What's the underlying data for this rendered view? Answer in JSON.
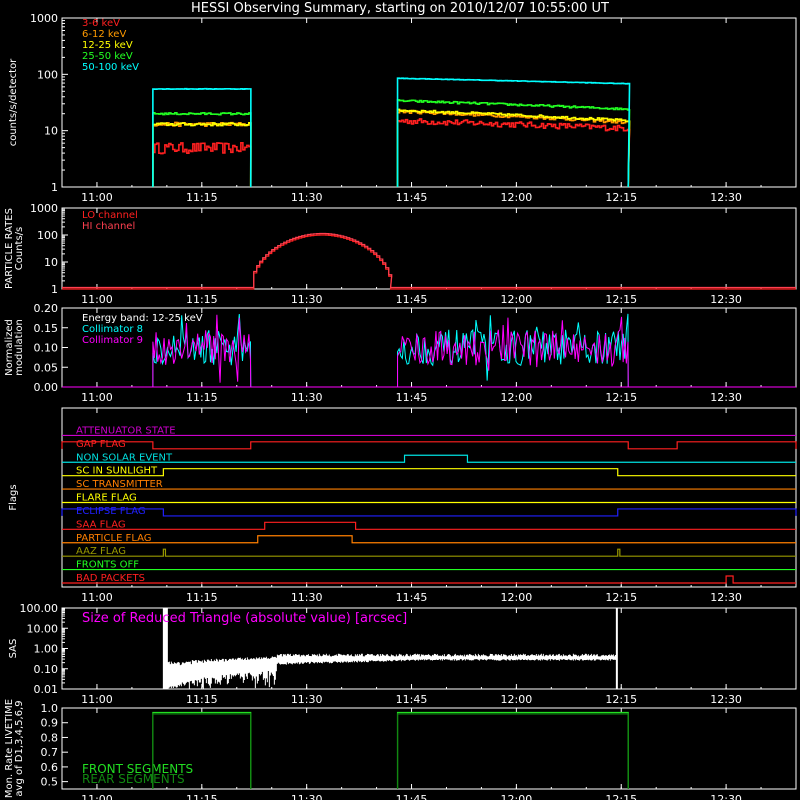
{
  "title": "HESSI Observing Summary, starting on 2010/12/07 10:55:00 UT",
  "colors": {
    "band_3_6": "#ff2020",
    "band_6_12": "#ff9a00",
    "band_12_25": "#ffff00",
    "band_25_50": "#22ff22",
    "band_50_100": "#00ffff",
    "lo_channel": "#ff2020",
    "hi_channel": "#ff4050",
    "coll8": "#00ffff",
    "coll9": "#ff00ff",
    "front": "#22dd22",
    "rear": "#118811",
    "sas": "#ffffff"
  },
  "time_axis": {
    "xlim_minutes": [
      -5,
      100
    ],
    "tick_labels": [
      "11:00",
      "11:15",
      "11:30",
      "11:45",
      "12:00",
      "12:15",
      "12:30"
    ],
    "tick_minutes": [
      0,
      15,
      30,
      45,
      60,
      75,
      90
    ]
  },
  "chart_data": [
    {
      "type": "line",
      "id": "count_rates",
      "ylabel": "counts/s/detector",
      "yscale": "log",
      "ylim": [
        1,
        1000
      ],
      "ytick_labels": [
        "1",
        "10",
        "100",
        "1000"
      ],
      "legend_placement": "top-left",
      "x_unit": "minutes after 11:00",
      "series": [
        {
          "name": "3-6 keV",
          "color_key": "band_3_6",
          "segments": [
            {
              "x": [
                8,
                22
              ],
              "level": 5,
              "noise": 0.22
            },
            {
              "x": [
                43,
                76
              ],
              "level": 15,
              "end_level": 11,
              "noise": 0.12
            }
          ]
        },
        {
          "name": "6-12 keV",
          "color_key": "band_6_12",
          "segments": [
            {
              "x": [
                8,
                22
              ],
              "level": 13,
              "noise": 0.08
            },
            {
              "x": [
                43,
                76
              ],
              "level": 22,
              "end_level": 14,
              "noise": 0.06
            }
          ]
        },
        {
          "name": "12-25 keV",
          "color_key": "band_12_25",
          "segments": [
            {
              "x": [
                8,
                22
              ],
              "level": 13,
              "noise": 0.06
            },
            {
              "x": [
                43,
                76
              ],
              "level": 23,
              "end_level": 15,
              "noise": 0.05
            }
          ]
        },
        {
          "name": "25-50 keV",
          "color_key": "band_25_50",
          "segments": [
            {
              "x": [
                8,
                22
              ],
              "level": 20,
              "noise": 0.04
            },
            {
              "x": [
                43,
                76
              ],
              "level": 34,
              "end_level": 24,
              "noise": 0.04
            }
          ]
        },
        {
          "name": "50-100 keV",
          "color_key": "band_50_100",
          "segments": [
            {
              "x": [
                8,
                22
              ],
              "level": 55,
              "noise": 0.01
            },
            {
              "x": [
                43,
                76
              ],
              "level": 85,
              "end_level": 68,
              "noise": 0.01
            }
          ]
        }
      ]
    },
    {
      "type": "line",
      "id": "particle_rates",
      "ylabel": "PARTICLE RATES",
      "ylabel2": "Counts/s",
      "yscale": "log",
      "ylim": [
        1,
        1000
      ],
      "ytick_labels": [
        "1",
        "10",
        "100",
        "1000"
      ],
      "series": [
        {
          "name": "LO channel",
          "color_key": "lo_channel"
        },
        {
          "name": "HI channel",
          "color_key": "hi_channel"
        }
      ],
      "profile": {
        "x_start": 22,
        "x_end": 42,
        "peak": 100,
        "baseline": 1
      }
    },
    {
      "type": "line",
      "id": "modulation",
      "ylabel": "Normalized",
      "ylabel2": "modulation",
      "ylim": [
        0,
        0.2
      ],
      "ytick_labels": [
        "0.00",
        "0.05",
        "0.10",
        "0.15",
        "0.20"
      ],
      "annotation": "Energy band: 12-25 keV",
      "series": [
        {
          "name": "Collimator 8",
          "color_key": "coll8",
          "segments": [
            {
              "x": [
                8,
                22
              ],
              "level": 0.1
            },
            {
              "x": [
                43,
                76
              ],
              "level": 0.1
            }
          ]
        },
        {
          "name": "Collimator 9",
          "color_key": "coll9",
          "segments": [
            {
              "x": [
                8,
                22
              ],
              "level": 0.1
            },
            {
              "x": [
                43,
                76
              ],
              "level": 0.1
            }
          ]
        }
      ]
    },
    {
      "type": "line",
      "id": "flags",
      "ylabel": "Flags",
      "flags": [
        {
          "name": "ATTENUATOR STATE",
          "color": "#cc00cc",
          "high_intervals": []
        },
        {
          "name": "GAP FLAG",
          "color": "#ff2020",
          "high_intervals": [
            [
              -5,
              8
            ],
            [
              22,
              76
            ],
            [
              83,
              100
            ]
          ]
        },
        {
          "name": "NON SOLAR EVENT",
          "color": "#00e0e0",
          "high_intervals": [
            [
              44,
              53
            ]
          ]
        },
        {
          "name": "SC IN SUNLIGHT",
          "color": "#ffff00",
          "high_intervals": [
            [
              9.5,
              74.5
            ]
          ]
        },
        {
          "name": "SC TRANSMITTER",
          "color": "#ff7f00",
          "high_intervals": []
        },
        {
          "name": "FLARE FLAG",
          "color": "#ffff00",
          "high_intervals": []
        },
        {
          "name": "ECLIPSE FLAG",
          "color": "#2020ff",
          "high_intervals": [
            [
              -5,
              9.5
            ],
            [
              74.5,
              100
            ]
          ]
        },
        {
          "name": "SAA FLAG",
          "color": "#ff2020",
          "high_intervals": [
            [
              24,
              37
            ]
          ]
        },
        {
          "name": "PARTICLE FLAG",
          "color": "#ff7f00",
          "high_intervals": [
            [
              23,
              36.5
            ]
          ]
        },
        {
          "name": "AAZ FLAG",
          "color": "#999900",
          "high_intervals": [
            [
              9.5,
              9.8
            ],
            [
              74.5,
              74.8
            ]
          ]
        },
        {
          "name": "FRONTS OFF",
          "color": "#22ff22",
          "high_intervals": []
        },
        {
          "name": "BAD PACKETS",
          "color": "#ff2020",
          "high_intervals": [
            [
              90,
              91
            ]
          ]
        }
      ]
    },
    {
      "type": "line",
      "id": "sas",
      "ylabel": "SAS",
      "yscale": "log",
      "ylim": [
        0.01,
        100
      ],
      "ytick_labels": [
        "0.01",
        "0.10",
        "1.00",
        "10.00",
        "100.00"
      ],
      "annotation": "Size of Reduced Triangle (absolute value) [arcsec]",
      "series": [
        {
          "name": "",
          "color_key": "sas",
          "x_range": [
            9.5,
            74.5
          ]
        }
      ]
    },
    {
      "type": "line",
      "id": "livetime",
      "ylabel": "Mon. Rate LIVETIME",
      "ylabel2": "avg of D1,3,4,5,6,9",
      "ylim": [
        0.45,
        1.0
      ],
      "ytick_labels": [
        "0.5",
        "0.6",
        "0.7",
        "0.8",
        "0.9",
        "1.0"
      ],
      "series": [
        {
          "name": "FRONT SEGMENTS",
          "color_key": "front",
          "segments": [
            {
              "x": [
                8,
                22
              ],
              "level": 0.97
            },
            {
              "x": [
                43,
                76
              ],
              "level": 0.97
            }
          ]
        },
        {
          "name": "REAR SEGMENTS",
          "color_key": "rear",
          "segments": [
            {
              "x": [
                8,
                22
              ],
              "level": 0.96
            },
            {
              "x": [
                43,
                76
              ],
              "level": 0.96
            }
          ]
        }
      ]
    }
  ]
}
